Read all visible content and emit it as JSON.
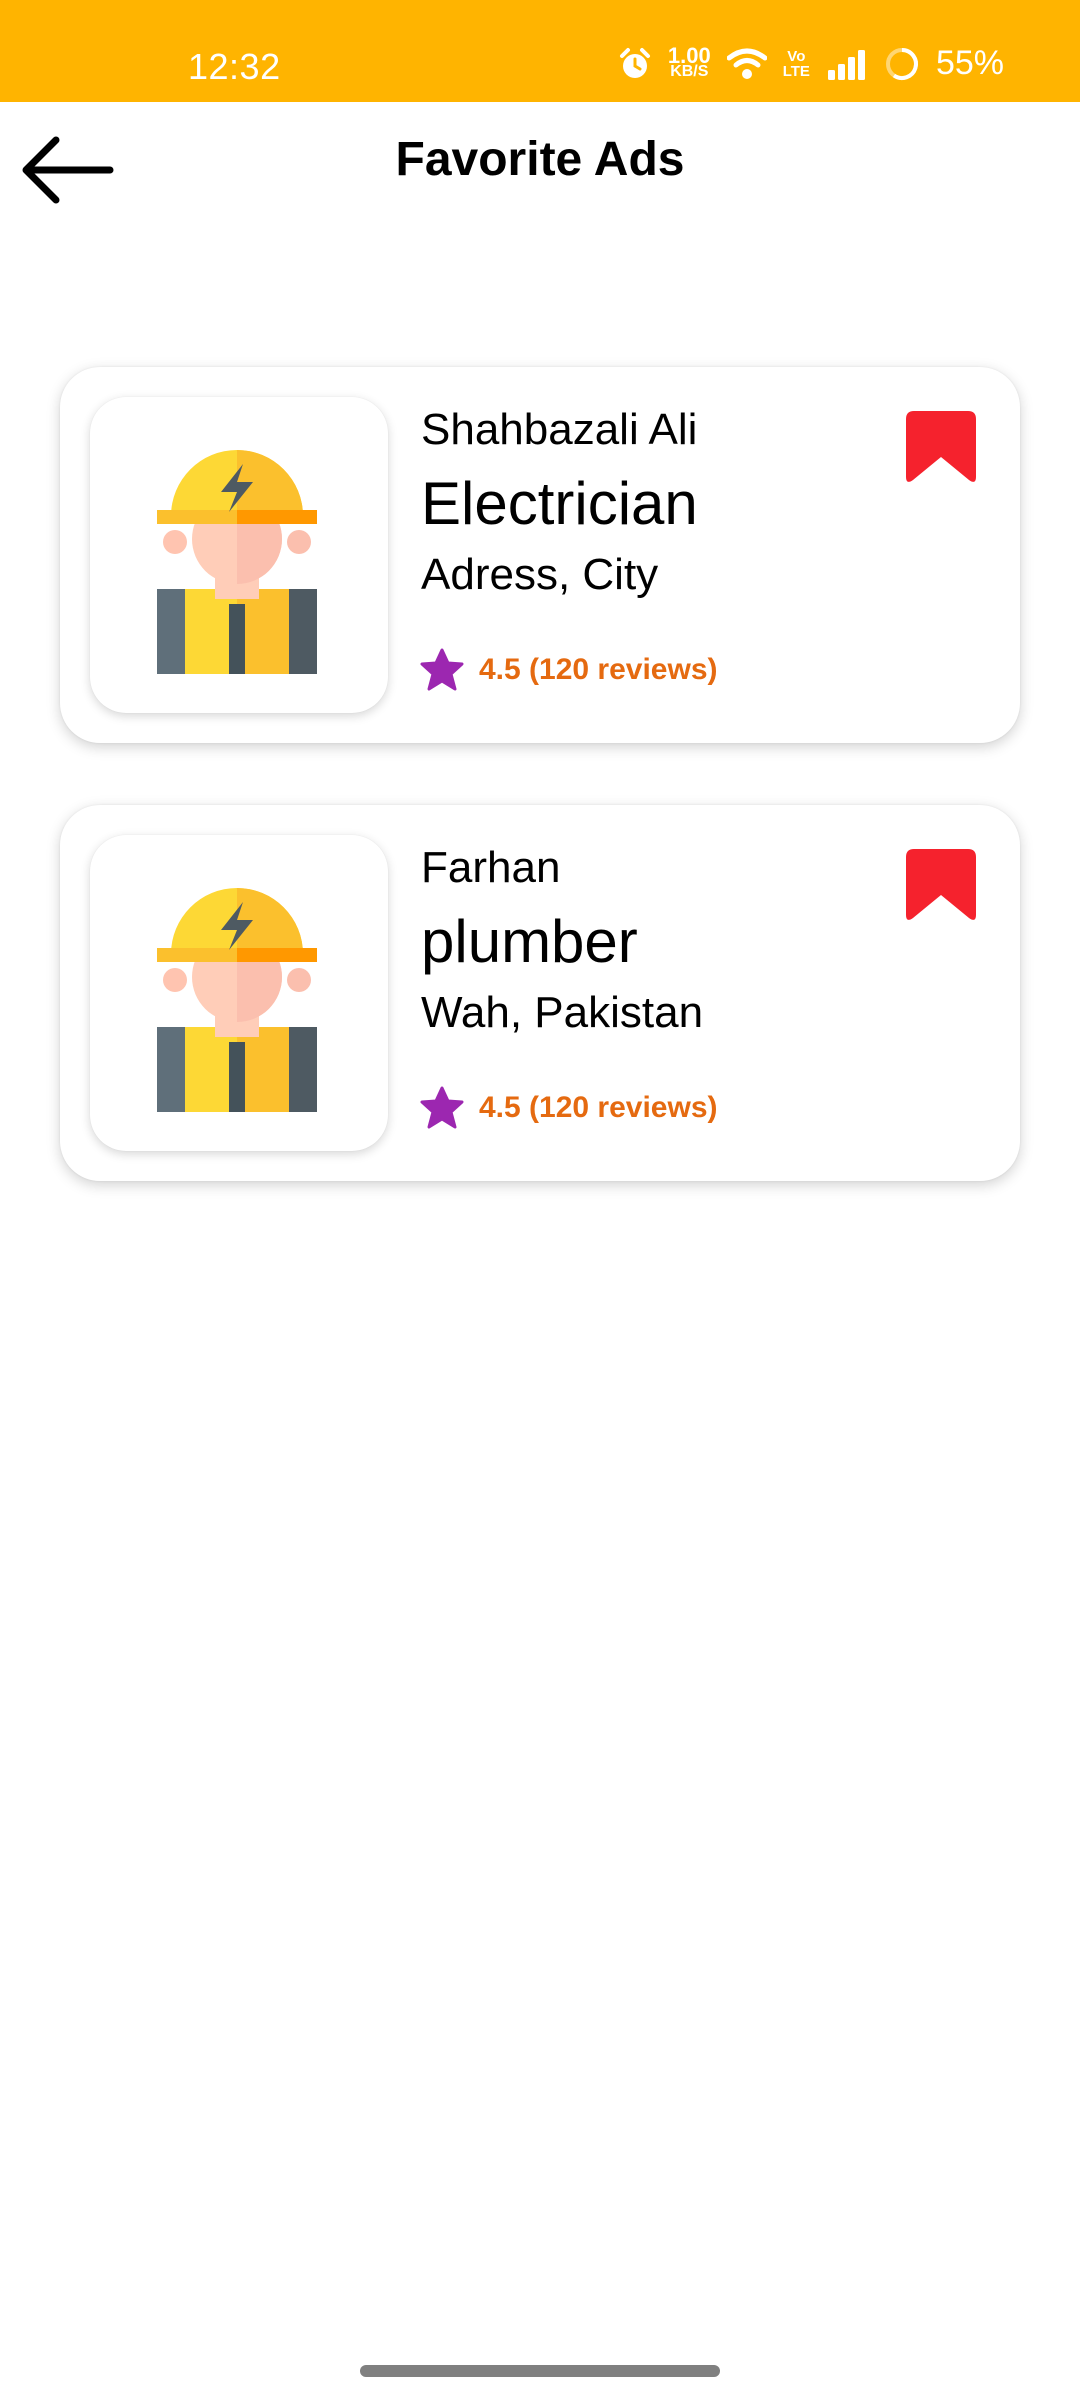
{
  "status_bar": {
    "time": "12:32",
    "net_speed_value": "1.00",
    "net_speed_unit": "KB/S",
    "volte_top": "Vo",
    "volte_bottom": "LTE",
    "battery": "55%"
  },
  "header": {
    "title": "Favorite Ads",
    "back_icon": "arrow-left-icon"
  },
  "ads": [
    {
      "name": "Shahbazali Ali",
      "profession": "Electrician",
      "location": "Adress, City",
      "rating": "4.5 (120 reviews)",
      "avatar_icon": "worker-avatar-icon",
      "bookmark_icon": "bookmark-filled-icon"
    },
    {
      "name": "Farhan",
      "profession": "plumber",
      "location": "Wah, Pakistan",
      "rating": "4.5 (120 reviews)",
      "avatar_icon": "worker-avatar-icon",
      "bookmark_icon": "bookmark-filled-icon"
    }
  ],
  "colors": {
    "status_bar": "#FFB400",
    "bookmark": "#F5222D",
    "star": "#9C27B0",
    "rating_text": "#E56A10"
  }
}
